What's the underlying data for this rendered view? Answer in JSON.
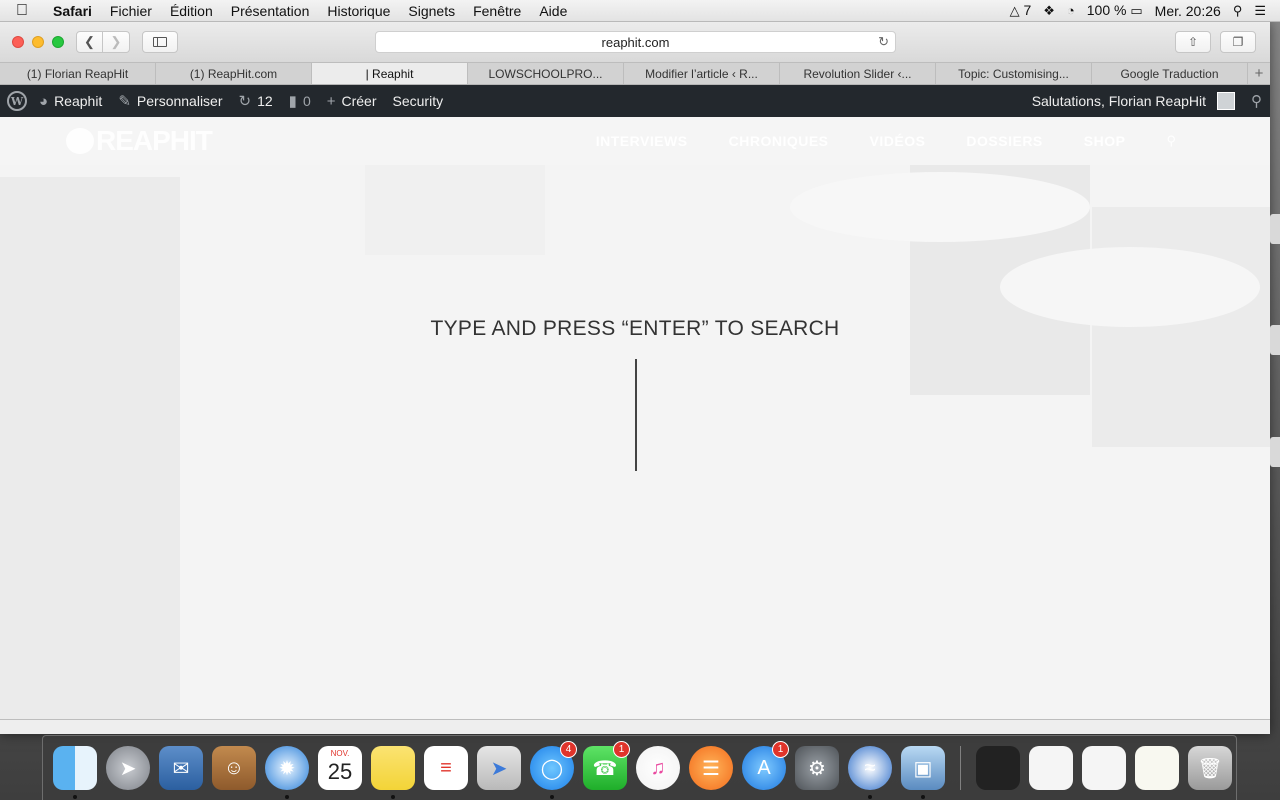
{
  "menubar": {
    "app_name": "Safari",
    "menus": [
      "Fichier",
      "Édition",
      "Présentation",
      "Historique",
      "Signets",
      "Fenêtre",
      "Aide"
    ],
    "adobe_count": "7",
    "battery": "100 %",
    "clock": "Mer. 20:26"
  },
  "browser": {
    "url": "reaphit.com",
    "tabs": [
      {
        "label": "(1) Florian ReapHit"
      },
      {
        "label": "(1) ReapHit.com"
      },
      {
        "label": "| Reaphit"
      },
      {
        "label": "LOWSCHOOLPRO..."
      },
      {
        "label": "Modifier l’article ‹ R..."
      },
      {
        "label": "Revolution Slider ‹..."
      },
      {
        "label": "Topic: Customising..."
      },
      {
        "label": "Google Traduction"
      }
    ]
  },
  "adminbar": {
    "site_name": "Reaphit",
    "customize": "Personnaliser",
    "updates_count": "12",
    "comments_count": "0",
    "new_label": "Créer",
    "security_label": "Security",
    "greeting": "Salutations, Florian ReapHit"
  },
  "site": {
    "logo_text": "REAPHIT",
    "nav": [
      "INTERVIEWS",
      "CHRONIQUES",
      "VIDÉOS",
      "DOSSIERS",
      "SHOP"
    ],
    "search_prompt": "TYPE AND PRESS “ENTER” TO SEARCH"
  },
  "dock": {
    "calendar_month": "NOV.",
    "calendar_day": "25",
    "messages_badge": "4",
    "facetime_badge": "1",
    "appstore_badge": "1"
  }
}
